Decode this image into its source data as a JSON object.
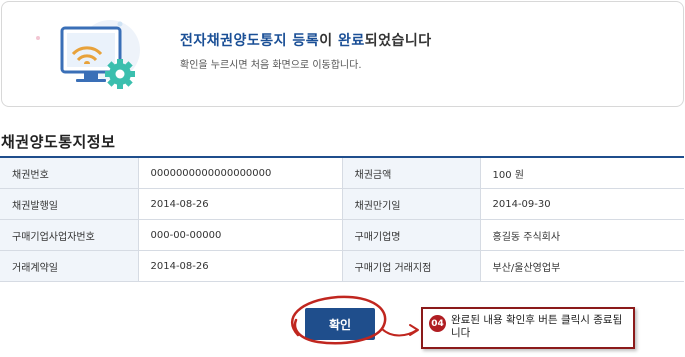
{
  "banner": {
    "title_highlight": "전자채권양도통지 등록",
    "title_mid": "이 ",
    "title_bold2": "완료",
    "title_end": "되었습니다",
    "subtitle": "확인을 누르시면 처음 화면으로 이동합니다."
  },
  "section_title": "채권양도통지정보",
  "rows": [
    {
      "l1": "채권번호",
      "v1": "0000000000000000000",
      "l2": "채권금액",
      "v2": "100 원"
    },
    {
      "l1": "채권발행일",
      "v1": "2014-08-26",
      "l2": "채권만기일",
      "v2": "2014-09-30"
    },
    {
      "l1": "구매기업사업자번호",
      "v1": "000-00-00000",
      "l2": "구매기업명",
      "v2": "홍길동 주식회사"
    },
    {
      "l1": "거래계약일",
      "v1": "2014-08-26",
      "l2": "구매기업 거래지점",
      "v2": "부산/울산영업부"
    }
  ],
  "confirm_label": "확인",
  "annotation": {
    "step": "04",
    "text": "완료된 내용 확인후 버튼 클릭시 종료됩니다"
  },
  "colors": {
    "accent": "#1f4e8c",
    "annotation_red": "#c0261f",
    "header_cell_bg": "#f1f5fa"
  },
  "icons": [
    "monitor-wifi-gear-icon"
  ]
}
